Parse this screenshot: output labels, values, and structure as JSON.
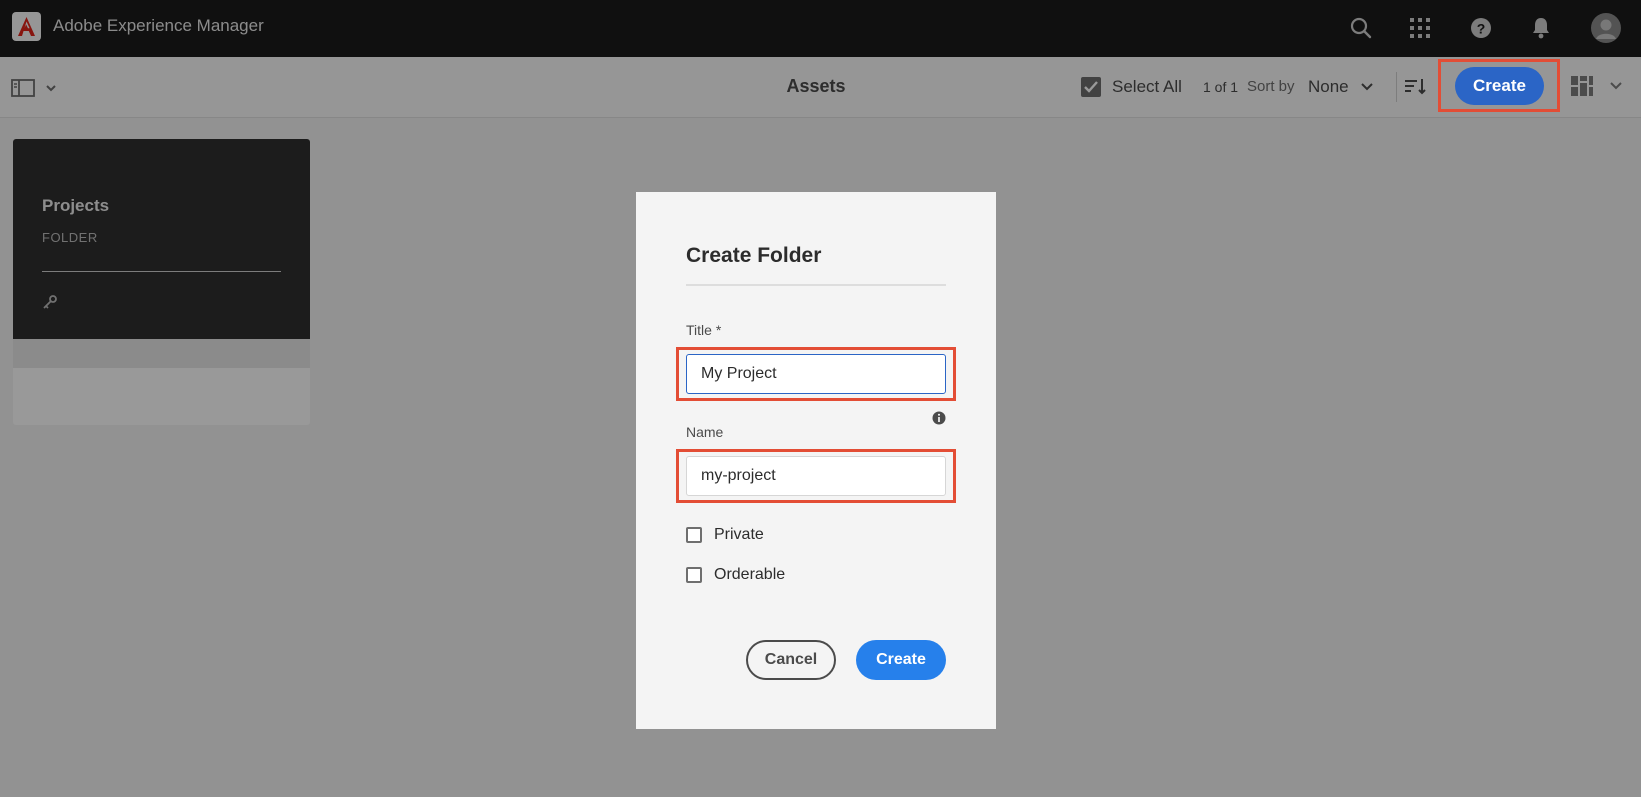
{
  "app": {
    "title": "Adobe Experience Manager"
  },
  "topbar": {
    "icons": [
      "search-icon",
      "apps-grid-icon",
      "help-icon",
      "notifications-icon",
      "user-avatar"
    ]
  },
  "actionbar": {
    "page_title": "Assets",
    "select_all": "Select All",
    "count": "1 of 1",
    "sort_by_label": "Sort by",
    "sort_value": "None",
    "create_label": "Create"
  },
  "content": {
    "card": {
      "title": "Projects",
      "subtitle": "FOLDER"
    }
  },
  "dialog": {
    "title": "Create Folder",
    "title_label": "Title *",
    "title_value": "My Project",
    "name_label": "Name",
    "name_value": "my-project",
    "private_label": "Private",
    "orderable_label": "Orderable",
    "cancel_label": "Cancel",
    "create_label": "Create"
  },
  "colors": {
    "accent": "#2680eb",
    "highlight": "#e34d35",
    "topbar": "#1c1c1c"
  }
}
